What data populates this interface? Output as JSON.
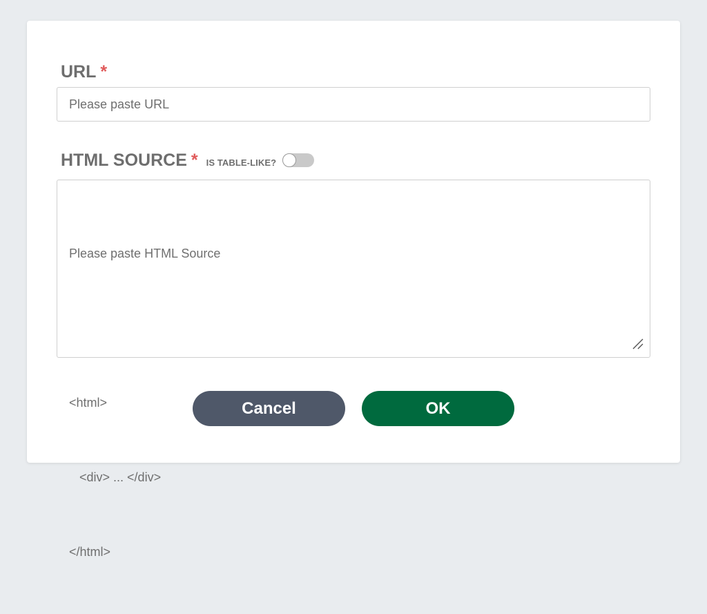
{
  "url_field": {
    "label": "URL",
    "required_mark": "*",
    "placeholder": "Please paste URL"
  },
  "html_field": {
    "label": "HTML SOURCE",
    "required_mark": "*",
    "table_like_label": "IS TABLE-LIKE?",
    "table_like_on": false,
    "placeholder_lines": [
      "Please paste HTML Source",
      "",
      "<html>",
      "   <div> ... </div>",
      "</html>"
    ]
  },
  "buttons": {
    "cancel_label": "Cancel",
    "ok_label": "OK"
  },
  "colors": {
    "cancel": "#4f5869",
    "ok": "#006a3e",
    "required": "#e05a5a",
    "label": "#6e6e6e"
  }
}
